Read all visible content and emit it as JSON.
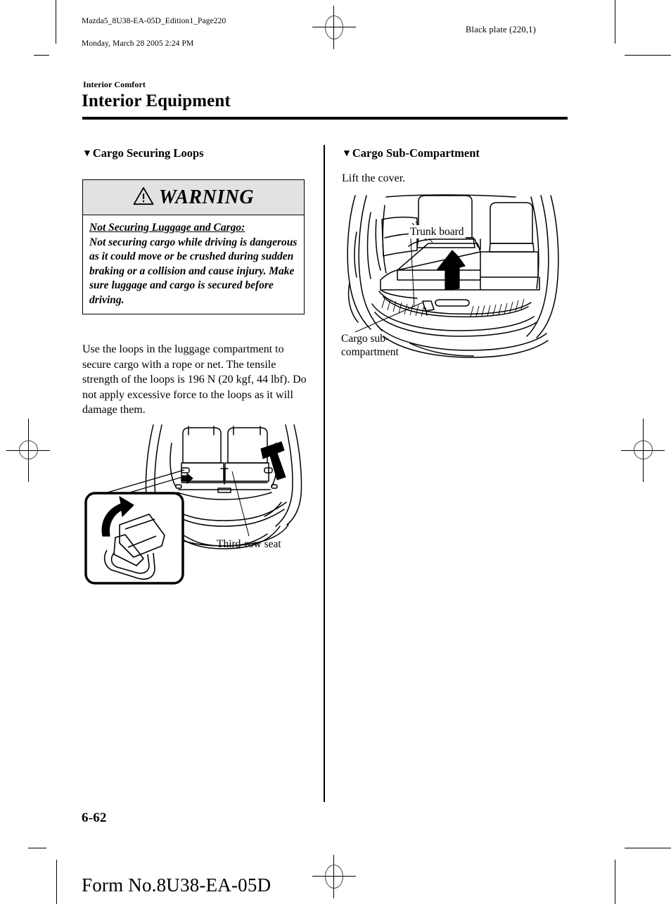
{
  "print_slug": {
    "file_line": "Mazda5_8U38-EA-05D_Edition1_Page220",
    "date_line": "Monday, March 28 2005 2:24 PM",
    "black_plate": "Black plate (220,1)"
  },
  "header": {
    "eyebrow": "Interior Comfort",
    "title": "Interior Equipment"
  },
  "columns": {
    "left": {
      "subhead_marker": "▼",
      "subhead": "Cargo Securing Loops",
      "warning": {
        "icon": "warning-triangle-icon",
        "label": "WARNING",
        "lead": "Not Securing Luggage and Cargo:",
        "text": "Not securing cargo while driving is dangerous as it could move or be crushed during sudden braking or a collision and cause injury. Make sure luggage and cargo is secured before driving.",
        "header_bg": "#e2e2e2"
      },
      "paragraph": "Use the loops in the luggage compartment to secure cargo with a rope or net. The tensile strength of the loops is 196 N (20 kgf, 44 lbf). Do not apply excessive force to the loops as it will damage them.",
      "figure": {
        "name": "cargo-securing-loops-illustration",
        "caption": "Third-row seat",
        "inset": "loop-detail-inset"
      }
    },
    "right": {
      "subhead_marker": "▼",
      "subhead": "Cargo Sub-Compartment",
      "paragraph": "Lift the cover.",
      "figure": {
        "name": "cargo-sub-compartment-illustration",
        "caption_top": "Trunk board",
        "caption_bottom": "Cargo sub-\ncompartment"
      }
    }
  },
  "footer": {
    "folio": "6-62",
    "form_no": "Form No.8U38-EA-05D"
  }
}
